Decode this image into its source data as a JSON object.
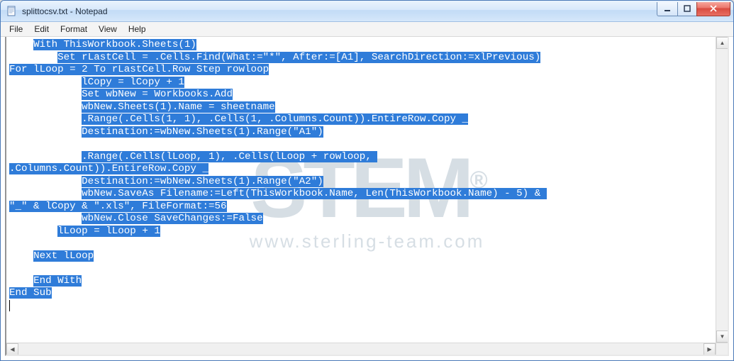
{
  "title": "splittocsv.txt - Notepad",
  "menubar": {
    "file": "File",
    "edit": "Edit",
    "format": "Format",
    "view": "View",
    "help": "Help"
  },
  "watermark": {
    "logo_text": "STEM",
    "url_text": "www.sterling-team.com"
  },
  "code_lines": [
    {
      "indent": "    ",
      "text": "With ThisWorkbook.Sheets(1)"
    },
    {
      "indent": "        ",
      "text": "Set rLastCell = .Cells.Find(What:=\"*\", After:=[A1], SearchDirection:=xlPrevious)"
    },
    {
      "indent": "",
      "text": "For lLoop = 2 To rLastCell.Row Step rowloop"
    },
    {
      "indent": "            ",
      "text": "lCopy = lCopy + 1"
    },
    {
      "indent": "            ",
      "text": "Set wbNew = Workbooks.Add"
    },
    {
      "indent": "            ",
      "text": "wbNew.Sheets(1).Name = sheetname"
    },
    {
      "indent": "            ",
      "text": ".Range(.Cells(1, 1), .Cells(1, .Columns.Count)).EntireRow.Copy _"
    },
    {
      "indent": "            ",
      "text": "Destination:=wbNew.Sheets(1).Range(\"A1\")"
    },
    {
      "indent": "            ",
      "text": ""
    },
    {
      "indent": "            ",
      "text": ".Range(.Cells(lLoop, 1), .Cells(lLoop + rowloop, "
    },
    {
      "indent": "",
      "text": ".Columns.Count)).EntireRow.Copy _"
    },
    {
      "indent": "            ",
      "text": "Destination:=wbNew.Sheets(1).Range(\"A2\")"
    },
    {
      "indent": "            ",
      "text": "wbNew.SaveAs Filename:=Left(ThisWorkbook.Name, Len(ThisWorkbook.Name) - 5) & "
    },
    {
      "indent": "",
      "text": "\"_\" & lCopy & \".xls\", FileFormat:=56"
    },
    {
      "indent": "            ",
      "text": "wbNew.Close SaveChanges:=False"
    },
    {
      "indent": "        ",
      "text": "lLoop = lLoop + 1"
    },
    {
      "indent": "        ",
      "text": ""
    },
    {
      "indent": "    ",
      "text": "Next lLoop"
    },
    {
      "indent": "    ",
      "text": ""
    },
    {
      "indent": "    ",
      "text": "End With"
    },
    {
      "indent": "",
      "text": "End Sub"
    }
  ]
}
